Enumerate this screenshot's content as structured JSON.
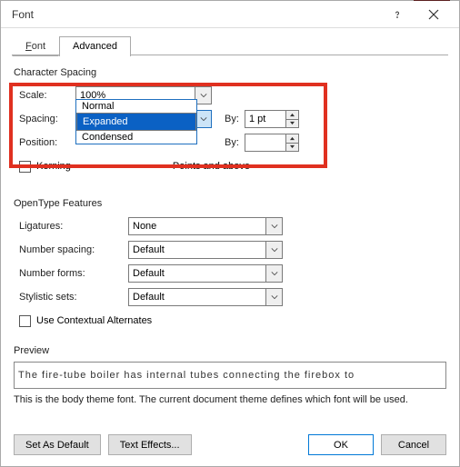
{
  "window": {
    "title": "Font"
  },
  "tabs": {
    "font": "Font",
    "advanced": "Advanced"
  },
  "charspacing": {
    "title": "Character Spacing",
    "scale_label": "Scale:",
    "scale_value": "100%",
    "spacing_label": "Spacing:",
    "spacing_value": "Expanded",
    "by1_label": "By:",
    "by1_value": "1 pt",
    "position_label": "Position:",
    "by2_label": "By:",
    "kerning_label": "Kerning",
    "points_label": "Points and above",
    "dropdown": {
      "normal": "Normal",
      "expanded": "Expanded",
      "condensed": "Condensed"
    }
  },
  "opentype": {
    "title": "OpenType Features",
    "ligatures_label": "Ligatures:",
    "ligatures_value": "None",
    "numspacing_label": "Number spacing:",
    "numspacing_value": "Default",
    "numforms_label": "Number forms:",
    "numforms_value": "Default",
    "stylistic_label": "Stylistic sets:",
    "stylistic_value": "Default",
    "contextual_label": "Use Contextual Alternates"
  },
  "preview": {
    "title": "Preview",
    "text": "The fire-tube boiler has internal tubes connecting the firebox to",
    "note": "This is the body theme font. The current document theme defines which font will be used."
  },
  "buttons": {
    "set_default": "Set As Default",
    "text_effects": "Text Effects...",
    "ok": "OK",
    "cancel": "Cancel"
  }
}
